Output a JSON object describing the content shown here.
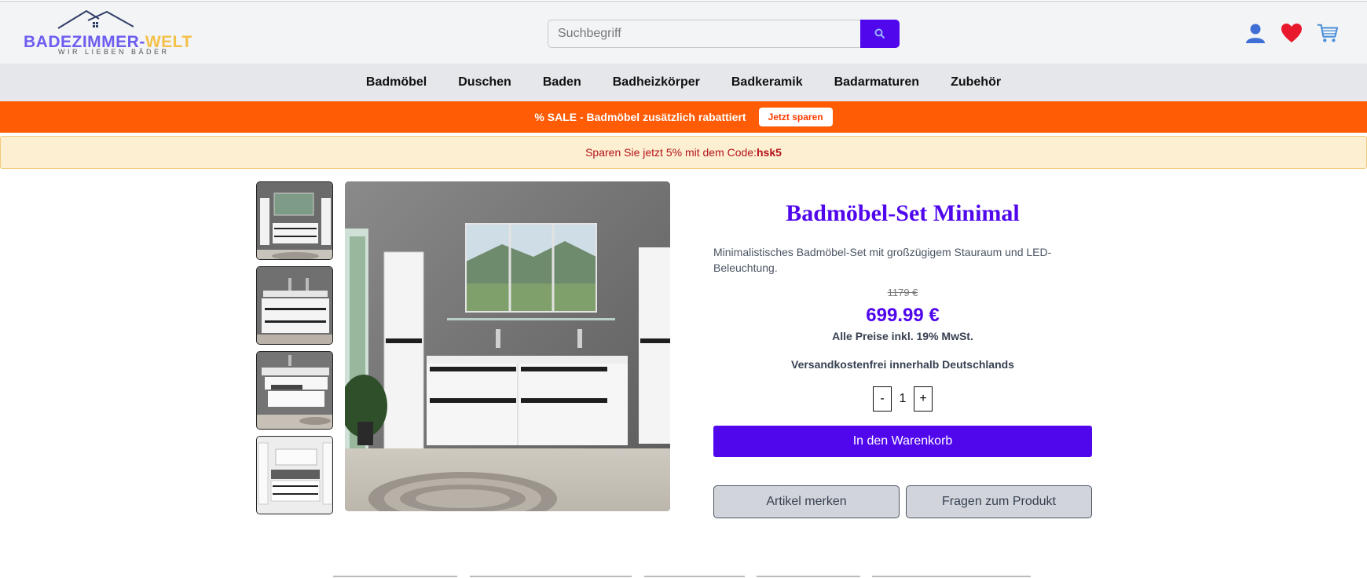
{
  "header": {
    "logo": {
      "main_part1": "BADEZIMMER-",
      "main_part2": "WELT",
      "tagline": "WIR LIEBEN BÄDER"
    },
    "search": {
      "placeholder": "Suchbegriff",
      "value": ""
    },
    "icons": [
      "user-icon",
      "heart-icon",
      "cart-icon"
    ]
  },
  "nav": {
    "items": [
      "Badmöbel",
      "Duschen",
      "Baden",
      "Badheizkörper",
      "Badkeramik",
      "Badarmaturen",
      "Zubehör"
    ]
  },
  "sale_banner": {
    "text": "% SALE - Badmöbel zusätzlich rabattiert",
    "button": "Jetzt sparen"
  },
  "code_banner": {
    "text": "Sparen Sie jetzt 5% mit dem Code:",
    "code": "hsk5"
  },
  "product": {
    "title": "Badmöbel-Set Minimal",
    "description": "Minimalistisches Badmöbel-Set mit großzügigem Stauraum und LED-Beleuchtung.",
    "old_price": "1179 €",
    "price": "699.99 €",
    "tax_note": "Alle Preise inkl. 19% MwSt.",
    "shipping": "Versandkostenfrei innerhalb Deutschlands",
    "quantity": {
      "minus": "-",
      "value": "1",
      "plus": "+"
    },
    "add_to_cart": "In den Warenkorb",
    "wishlist": "Artikel merken",
    "question": "Fragen zum Produkt"
  },
  "colors": {
    "accent": "#5007ec",
    "sale": "#ff5c05",
    "code_bg": "#fdefd2",
    "code_text": "#b4131b"
  }
}
